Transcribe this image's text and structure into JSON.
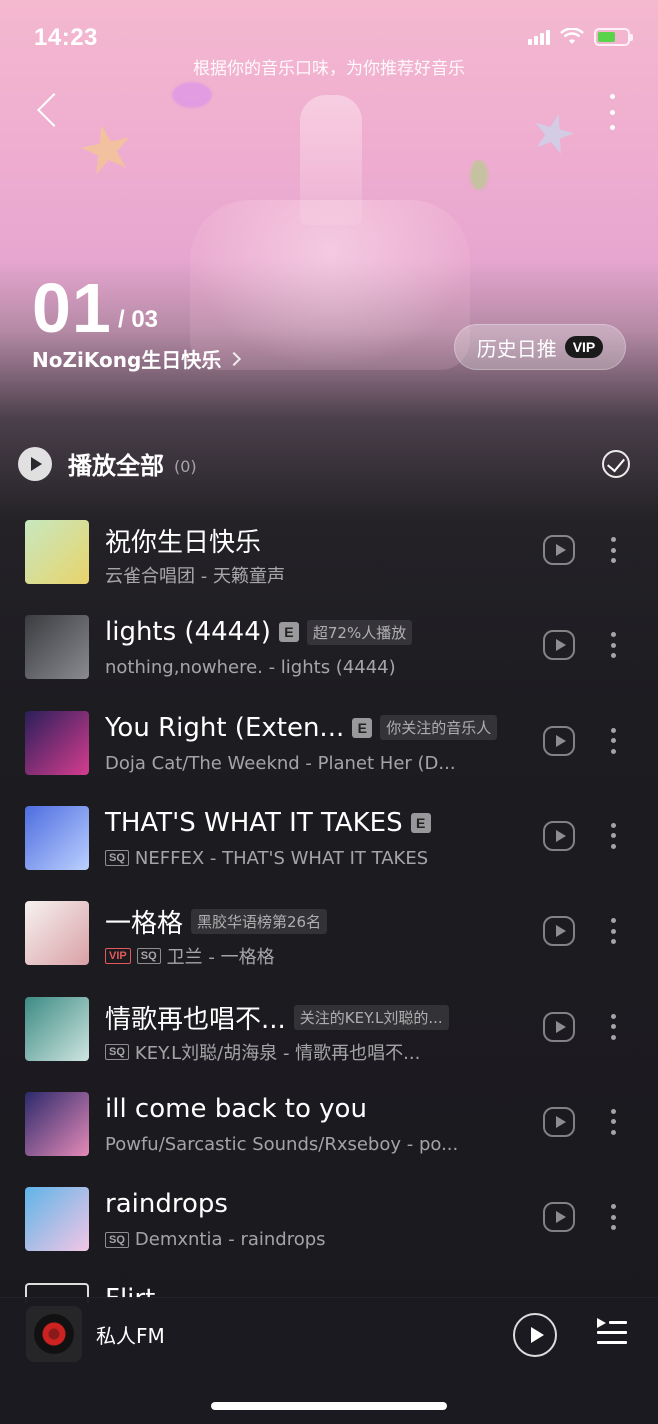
{
  "status_bar": {
    "time": "14:23"
  },
  "header": {
    "subtitle": "根据你的音乐口味，为你推荐好音乐",
    "day_number": "01",
    "day_total": "/ 03",
    "owner": "NoZiKong生日快乐",
    "history_label": "历史日推",
    "vip_label": "VIP"
  },
  "play_all": {
    "label": "播放全部",
    "count": "(0)"
  },
  "songs": [
    {
      "title": "祝你生日快乐",
      "artist": "云雀合唱团 - 天籁童声",
      "cover": [
        "#c7e8c0",
        "#e8d36a"
      ]
    },
    {
      "title": "lights (4444)",
      "explicit": "E",
      "tag": "超72%人播放",
      "artist": "nothing,nowhere. - lights (4444)",
      "cover": [
        "#3b3c40",
        "#8a8b90"
      ]
    },
    {
      "title": "You Right (Exten...",
      "explicit": "E",
      "tag": "你关注的音乐人",
      "artist": "Doja Cat/The Weeknd - Planet Her (D...",
      "cover": [
        "#2a1f5a",
        "#d63d8f"
      ]
    },
    {
      "title": "THAT'S WHAT IT TAKES",
      "explicit": "E",
      "quality": "SQ",
      "artist": "NEFFEX - THAT'S WHAT IT TAKES",
      "cover": [
        "#4e6de0",
        "#bcd0ff"
      ]
    },
    {
      "title": "一格格",
      "tag": "黑胶华语榜第26名",
      "vip": "VIP",
      "quality": "SQ",
      "artist": "卫兰 - 一格格",
      "cover": [
        "#f6f2ef",
        "#d9a0a6"
      ]
    },
    {
      "title": "情歌再也唱不...",
      "tag": "关注的KEY.L刘聪的...",
      "quality": "SQ",
      "artist": "KEY.L刘聪/胡海泉 - 情歌再也唱不...",
      "cover": [
        "#3d8b85",
        "#cfe5df"
      ]
    },
    {
      "title": "ill come back to you",
      "artist": "Powfu/Sarcastic Sounds/Rxseboy - po...",
      "cover": [
        "#2c2a6b",
        "#e58ab8"
      ]
    },
    {
      "title": "raindrops",
      "quality": "SQ",
      "artist": "Demxntia - raindrops",
      "cover": [
        "#5fb4e8",
        "#f3c6e5"
      ]
    }
  ],
  "partial_song": {
    "title": "Flirt"
  },
  "mini_player": {
    "label": "私人FM"
  }
}
